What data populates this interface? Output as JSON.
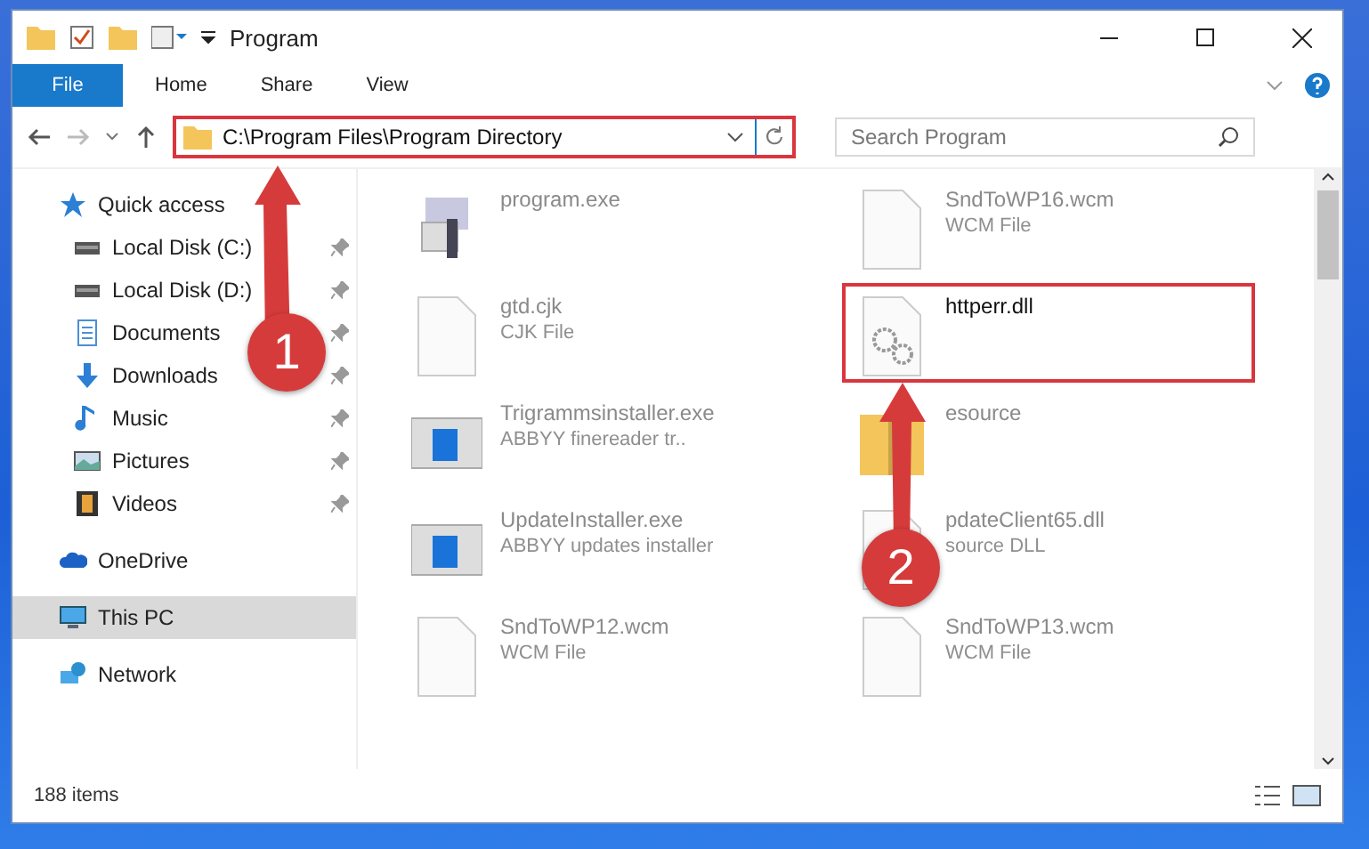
{
  "window": {
    "title": "Program"
  },
  "ribbon_tabs": [
    {
      "label": "File",
      "selected": true
    },
    {
      "label": "Home",
      "selected": false
    },
    {
      "label": "Share",
      "selected": false
    },
    {
      "label": "View",
      "selected": false
    }
  ],
  "address": {
    "path": "C:\\Program Files\\Program Directory"
  },
  "search": {
    "placeholder": "Search Program"
  },
  "sidebar": {
    "items": [
      {
        "label": "Quick access",
        "kind": "star",
        "selected": false,
        "children": [
          {
            "label": "Local Disk (C:)",
            "kind": "drive",
            "pinned": true,
            "selected": false
          },
          {
            "label": "Local Disk (D:)",
            "kind": "drive",
            "pinned": true,
            "selected": false
          },
          {
            "label": "Documents",
            "kind": "doc",
            "pinned": true,
            "selected": false
          },
          {
            "label": "Downloads",
            "kind": "download",
            "pinned": true,
            "selected": false
          },
          {
            "label": "Music",
            "kind": "music",
            "pinned": true,
            "selected": false
          },
          {
            "label": "Pictures",
            "kind": "pictures",
            "pinned": true,
            "selected": false
          },
          {
            "label": "Videos",
            "kind": "videos",
            "pinned": true,
            "selected": false
          }
        ]
      },
      {
        "label": "OneDrive",
        "kind": "cloud",
        "selected": false
      },
      {
        "label": "This PC",
        "kind": "pc",
        "selected": true
      },
      {
        "label": "Network",
        "kind": "network",
        "selected": false
      }
    ]
  },
  "files": [
    {
      "name": "program.exe",
      "kind": "exe",
      "highlighted": false
    },
    {
      "name": "SndToWP16.wcm",
      "type": "WCM File",
      "kind": "file",
      "highlighted": false
    },
    {
      "name": "gtd.cjk",
      "type": "CJK File",
      "kind": "file",
      "highlighted": false
    },
    {
      "name": "httperr.dll",
      "kind": "dll",
      "highlighted": true
    },
    {
      "name": "Trigrammsinstaller.exe",
      "type": "ABBYY finereader tr..",
      "kind": "installer",
      "highlighted": false
    },
    {
      "name": "esource",
      "kind": "zip",
      "highlighted": false
    },
    {
      "name": "UpdateInstaller.exe",
      "type": "ABBYY updates installer",
      "kind": "installer",
      "highlighted": false
    },
    {
      "name": "pdateClient65.dll",
      "type": "source DLL",
      "kind": "dll",
      "highlighted": false
    },
    {
      "name": "SndToWP12.wcm",
      "type": "WCM File",
      "kind": "file",
      "highlighted": false
    },
    {
      "name": "SndToWP13.wcm",
      "type": "WCM File",
      "kind": "file",
      "highlighted": false
    }
  ],
  "status_bar": {
    "count": "188 items"
  },
  "annotations": [
    {
      "number": "1"
    },
    {
      "number": "2"
    }
  ]
}
